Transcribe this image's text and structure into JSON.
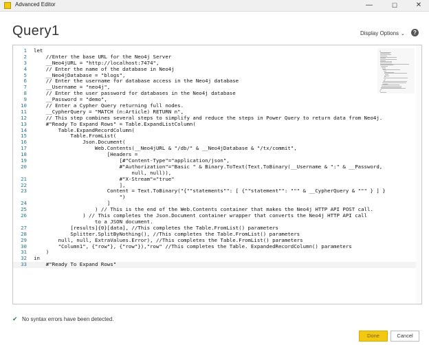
{
  "window": {
    "title": "Advanced Editor",
    "minimize_glyph": "—",
    "maximize_glyph": "☐",
    "close_glyph": "✕"
  },
  "header": {
    "query_name": "Query1",
    "display_options_label": "Display Options",
    "display_options_chevron": "⌄",
    "help_glyph": "?"
  },
  "editor": {
    "lines": [
      {
        "n": "1",
        "text": "let"
      },
      {
        "n": "2",
        "text": "    //Enter the base URL for the Neo4j Server"
      },
      {
        "n": "3",
        "text": "    __Neo4jURL = \"http://localhost:7474\","
      },
      {
        "n": "4",
        "text": "    // Enter the name of the database in Neo4j"
      },
      {
        "n": "5",
        "text": "    __Neo4jDatabase = \"blogs\","
      },
      {
        "n": "6",
        "text": "    // Enter the username for database access in the Neo4j database"
      },
      {
        "n": "7",
        "text": "    __Username = \"neo4j\","
      },
      {
        "n": "8",
        "text": "    // Enter the user password for databases in the Neo4j database"
      },
      {
        "n": "9",
        "text": "    __Password = \"demo\","
      },
      {
        "n": "10",
        "text": "    // Enter a Cypher Query returning full nodes."
      },
      {
        "n": "11",
        "text": "    __CypherQuery = \"MATCH (n:Article) RETURN n\","
      },
      {
        "n": "12",
        "text": "    // This step combines several steps to simplify and reduce the steps in Power Query to return data from Neo4j."
      },
      {
        "n": "13",
        "text": "    #\"Ready To Expand Rows\" = Table.ExpandListColumn("
      },
      {
        "n": "14",
        "text": "        Table.ExpandRecordColumn("
      },
      {
        "n": "15",
        "text": "            Table.FromList("
      },
      {
        "n": "16",
        "text": "                Json.Document("
      },
      {
        "n": "17",
        "text": "                    Web.Contents(__Neo4jURL & \"/db/\" & __Neo4jDatabase & \"/tx/commit\","
      },
      {
        "n": "18",
        "text": "                        [Headers ="
      },
      {
        "n": "19",
        "text": "                            [#\"Content-Type\"=\"application/json\","
      },
      {
        "n": "20",
        "text": "                            #\"Authorization\"=\"Basic \" & Binary.ToText(Text.ToBinary(__Username & \":\" & __Password,"
      },
      {
        "n": "",
        "text": "                                null, null)),"
      },
      {
        "n": "21",
        "text": "                            #\"X-Stream\"=\"true\""
      },
      {
        "n": "22",
        "text": "                            ],"
      },
      {
        "n": "23",
        "text": "                        Content = Text.ToBinary(\"{\"\"statements\"\": [ {\"\"statement\"\": \"\"\" & __CypherQuery & \"\"\" } ] }"
      },
      {
        "n": "",
        "text": "                            \")"
      },
      {
        "n": "24",
        "text": "                        ]"
      },
      {
        "n": "25",
        "text": "                    ) // This is the end of the Web.Contents container that makes the Neo4j HTTP API POST call."
      },
      {
        "n": "26",
        "text": "                ) // This completes the Json.Document container wrapper that converts the Neo4j HTTP API call"
      },
      {
        "n": "",
        "text": "                    to a JSON document."
      },
      {
        "n": "27",
        "text": "            [results]{0}[data], //This completes the Table.FromList() parameters"
      },
      {
        "n": "28",
        "text": "            Splitter.SplitByNothing(), //This completes the Table.FromList() parameters"
      },
      {
        "n": "29",
        "text": "        null, null, ExtraValues.Error), //This completes the Table.FromList() parameters"
      },
      {
        "n": "30",
        "text": "        \"Column1\", {\"row\"}, {\"row\"}),\"row\" //This completes the Table. ExpandedRecordColumn() parameters"
      },
      {
        "n": "31",
        "text": "    )"
      },
      {
        "n": "32",
        "text": "in"
      },
      {
        "n": "33",
        "text": "    #\"Ready To Expand Rows\""
      }
    ]
  },
  "status": {
    "icon": "check-icon",
    "message": "No syntax errors have been detected."
  },
  "buttons": {
    "done_label": "Done",
    "cancel_label": "Cancel"
  },
  "colors": {
    "accent": "#f2c811",
    "line_numbers": "#237893",
    "ok_check": "#2e8540"
  }
}
